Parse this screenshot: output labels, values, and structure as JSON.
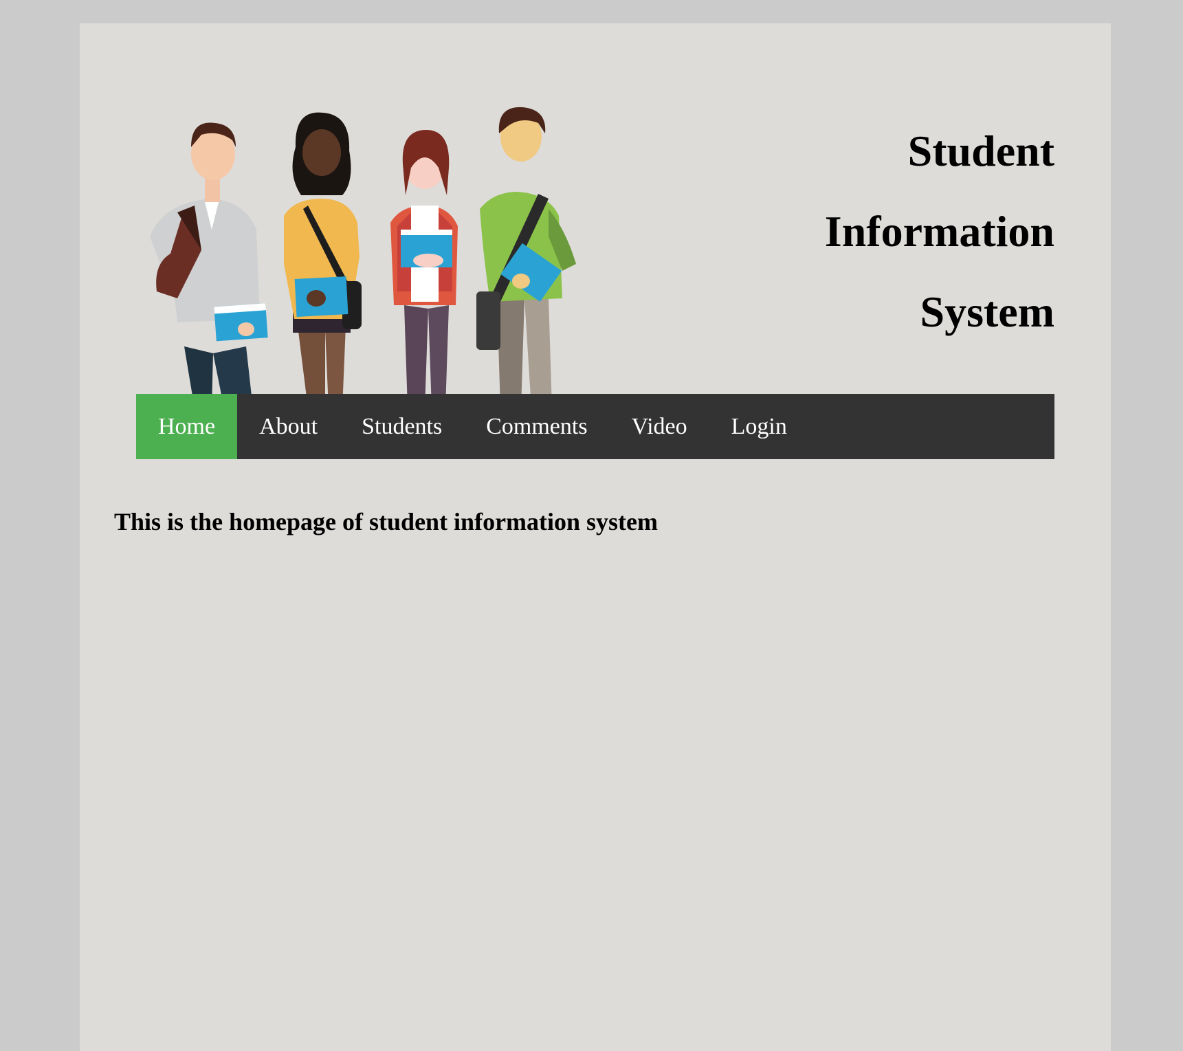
{
  "header": {
    "title_lines": [
      "Student",
      "Information",
      "System"
    ],
    "hero_image": "students-illustration"
  },
  "nav": {
    "items": [
      {
        "label": "Home",
        "active": true
      },
      {
        "label": "About",
        "active": false
      },
      {
        "label": "Students",
        "active": false
      },
      {
        "label": "Comments",
        "active": false
      },
      {
        "label": "Video",
        "active": false
      },
      {
        "label": "Login",
        "active": false
      }
    ],
    "active_color": "#4caf50",
    "bar_color": "#333333"
  },
  "main": {
    "heading": "This is the homepage of student information system"
  },
  "colors": {
    "background": "#cbcbcb",
    "page": "#dedcd9"
  }
}
